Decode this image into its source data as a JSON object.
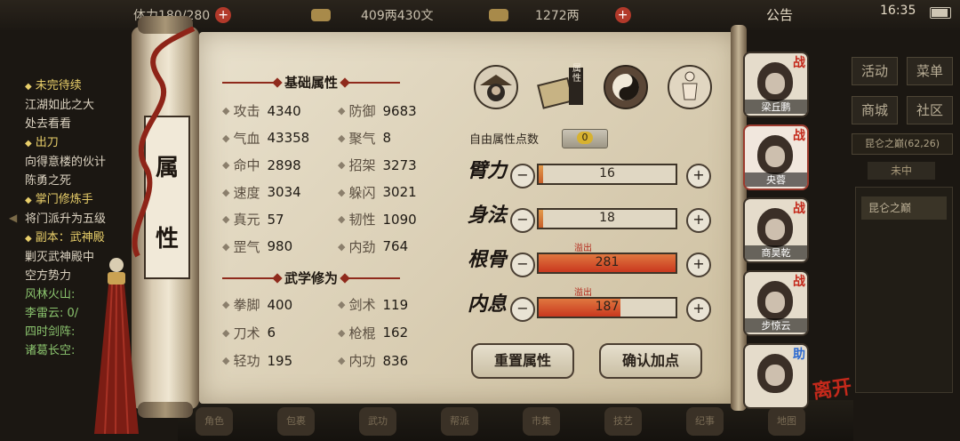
{
  "topbar": {
    "stamina": "体力180/280",
    "copper": "409两430文",
    "silver": "1272两",
    "notice": "公告",
    "time": "16:35"
  },
  "quest_panel": [
    {
      "type": "h",
      "text": "未完待续"
    },
    {
      "type": "w",
      "text": "江湖如此之大"
    },
    {
      "type": "w",
      "text": "处去看看"
    },
    {
      "type": "h",
      "text": "出刀"
    },
    {
      "type": "w",
      "text": "向得意楼的伙计"
    },
    {
      "type": "w",
      "text": "陈勇之死"
    },
    {
      "type": "h",
      "text": "掌门修炼手"
    },
    {
      "type": "w",
      "text": "将门派升为五级"
    },
    {
      "type": "h",
      "text": "副本：武神殿"
    },
    {
      "type": "w",
      "text": "剿灭武神殿中"
    },
    {
      "type": "w",
      "text": "空方势力"
    },
    {
      "type": "g",
      "text": "风林火山:"
    },
    {
      "type": "g",
      "text": "李雷云: 0/"
    },
    {
      "type": "g",
      "text": "四时剑阵:"
    },
    {
      "type": "g",
      "text": "诸葛长空:"
    }
  ],
  "right_menu": {
    "buttons": [
      "活动",
      "菜单",
      "商城",
      "社区"
    ],
    "location": "昆仑之巅(62,26)",
    "location_sub": "未中",
    "list_item": "昆仑之巅"
  },
  "scroll_title": [
    "属",
    "性"
  ],
  "basic": {
    "title": "基础属性",
    "stats": [
      {
        "name": "攻击",
        "value": "4340"
      },
      {
        "name": "防御",
        "value": "9683"
      },
      {
        "name": "气血",
        "value": "43358"
      },
      {
        "name": "聚气",
        "value": "8"
      },
      {
        "name": "命中",
        "value": "2898"
      },
      {
        "name": "招架",
        "value": "3273"
      },
      {
        "name": "速度",
        "value": "3034"
      },
      {
        "name": "躲闪",
        "value": "3021"
      },
      {
        "name": "真元",
        "value": "57"
      },
      {
        "name": "韧性",
        "value": "1090"
      },
      {
        "name": "罡气",
        "value": "980"
      },
      {
        "name": "内劲",
        "value": "764"
      }
    ]
  },
  "martial": {
    "title": "武学修为",
    "stats": [
      {
        "name": "拳脚",
        "value": "400"
      },
      {
        "name": "剑术",
        "value": "119"
      },
      {
        "name": "刀术",
        "value": "6"
      },
      {
        "name": "枪棍",
        "value": "162"
      },
      {
        "name": "轻功",
        "value": "195"
      },
      {
        "name": "内功",
        "value": "836"
      }
    ]
  },
  "tab_label": "属性",
  "free_points": {
    "label": "自由属性点数",
    "value": "0"
  },
  "attributes": [
    {
      "name": "臂力",
      "value": "16",
      "fill": 0.03,
      "overflow": ""
    },
    {
      "name": "身法",
      "value": "18",
      "fill": 0.03,
      "overflow": ""
    },
    {
      "name": "根骨",
      "value": "281",
      "fill": 1.0,
      "overflow": "溢出"
    },
    {
      "name": "内息",
      "value": "187",
      "fill": 0.6,
      "overflow": "溢出"
    }
  ],
  "buttons": {
    "reset": "重置属性",
    "confirm": "确认加点"
  },
  "characters": [
    {
      "name": "梁丘鹏",
      "badge": "战"
    },
    {
      "name": "央蓉",
      "badge": "战"
    },
    {
      "name": "商昊乾",
      "badge": "战"
    },
    {
      "name": "步惊云",
      "badge": "战"
    },
    {
      "name": "",
      "badge": "助"
    }
  ],
  "leave": "离开",
  "bottom_icons": [
    "角色",
    "包裹",
    "武功",
    "帮派",
    "市集",
    "技艺",
    "纪事",
    "地图"
  ],
  "colors": {
    "accent": "#8f2a1c",
    "badge": "#c4291b",
    "bar_fill": "#d4502e"
  }
}
